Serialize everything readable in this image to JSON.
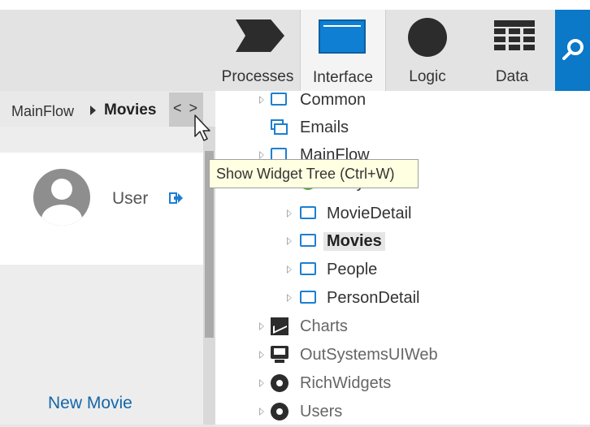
{
  "toolbar": {
    "tabs": [
      {
        "label": "Processes",
        "icon": "processes-chevron-icon"
      },
      {
        "label": "Interface",
        "icon": "interface-screen-icon",
        "selected": true
      },
      {
        "label": "Logic",
        "icon": "logic-circle-icon"
      },
      {
        "label": "Data",
        "icon": "data-grid-icon"
      }
    ],
    "search_icon": "search-icon",
    "accent_color": "#0b78c8"
  },
  "breadcrumb": {
    "parent": "MainFlow",
    "current": "Movies",
    "toggle_glyph": "< >"
  },
  "preview": {
    "user_label": "User",
    "new_movie_label": "New Movie"
  },
  "tree": {
    "items": [
      {
        "label": "Common",
        "icon": "ui-flow-icon"
      },
      {
        "label": "Emails",
        "icon": "emails-icon"
      },
      {
        "label": "MainFlow",
        "icon": "ui-flow-icon"
      },
      {
        "label": "Entry",
        "icon": "entry-icon"
      },
      {
        "label": "MovieDetail",
        "icon": "screen-icon"
      },
      {
        "label": "Movies",
        "icon": "screen-icon",
        "selected": true
      },
      {
        "label": "People",
        "icon": "screen-icon"
      },
      {
        "label": "PersonDetail",
        "icon": "screen-icon"
      },
      {
        "label": "Charts",
        "icon": "charts-icon"
      },
      {
        "label": "OutSystemsUIWeb",
        "icon": "outsystems-ui-icon"
      },
      {
        "label": "RichWidgets",
        "icon": "module-icon"
      },
      {
        "label": "Users",
        "icon": "module-icon"
      }
    ]
  },
  "tooltip": {
    "text": "Show Widget Tree (Ctrl+W)"
  }
}
